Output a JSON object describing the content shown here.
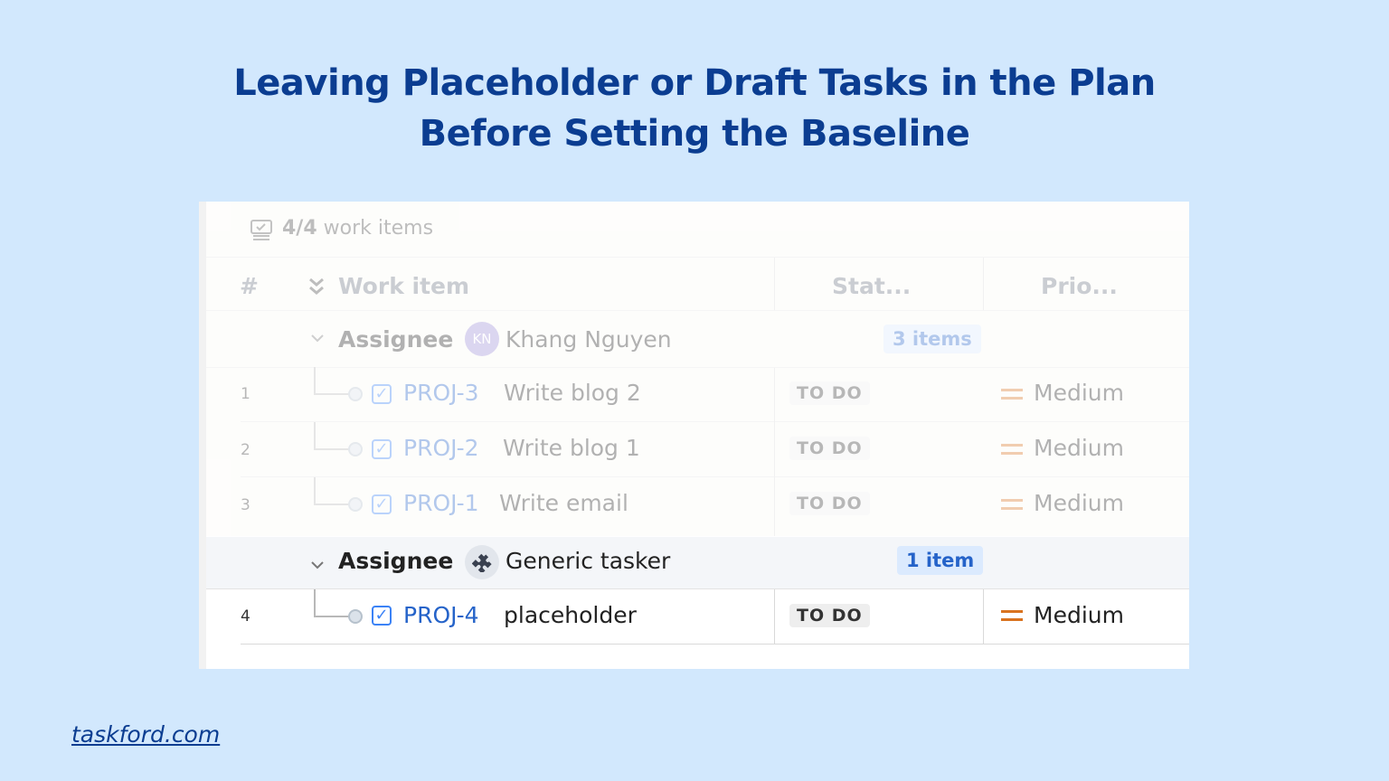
{
  "headline": {
    "line1": "Leaving Placeholder or Draft Tasks in the Plan",
    "line2": "Before Setting the Baseline"
  },
  "footer": {
    "link": "taskford.com"
  },
  "toolbar": {
    "count": "4/4",
    "count_label": "work items"
  },
  "columns": {
    "number": "#",
    "work_item": "Work item",
    "status": "Stat...",
    "priority": "Prio..."
  },
  "groups": [
    {
      "label": "Assignee",
      "assignee": "Khang Nguyen",
      "avatar_initials": "KN",
      "count": "3 items",
      "rows": [
        {
          "num": "1",
          "key": "PROJ-3",
          "title": "Write blog 2",
          "status": "TO DO",
          "priority": "Medium"
        },
        {
          "num": "2",
          "key": "PROJ-2",
          "title": "Write blog 1",
          "status": "TO DO",
          "priority": "Medium"
        },
        {
          "num": "3",
          "key": "PROJ-1",
          "title": "Write email",
          "status": "TO DO",
          "priority": "Medium"
        }
      ]
    },
    {
      "label": "Assignee",
      "assignee": "Generic tasker",
      "count": "1 item",
      "rows": [
        {
          "num": "4",
          "key": "PROJ-4",
          "title": "placeholder",
          "status": "TO DO",
          "priority": "Medium"
        }
      ]
    }
  ],
  "icons": {
    "work_items": "work-items-icon",
    "collapse_all": "double-chevron-icon",
    "group_toggle": "chevron-down-icon",
    "generic_avatar": "puzzle-icon",
    "task_type": "checkbox-icon",
    "priority": "medium-priority-icon"
  },
  "colors": {
    "background": "#d2e8fd",
    "headline": "#0b3d91",
    "key_link": "#2563c9",
    "priority_medium": "#d9731f"
  }
}
